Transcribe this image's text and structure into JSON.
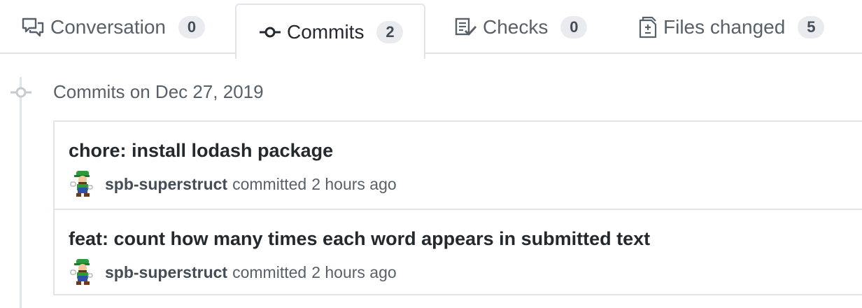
{
  "tabs": [
    {
      "label": "Conversation",
      "count": "0",
      "icon": "comment-discussion-icon",
      "selected": false
    },
    {
      "label": "Commits",
      "count": "2",
      "icon": "git-commit-icon",
      "selected": true
    },
    {
      "label": "Checks",
      "count": "0",
      "icon": "checklist-icon",
      "selected": false
    },
    {
      "label": "Files changed",
      "count": "5",
      "icon": "file-diff-icon",
      "selected": false
    }
  ],
  "commit_group": {
    "header": "Commits on Dec 27, 2019",
    "commits": [
      {
        "title": "chore: install lodash package",
        "author": "spb-superstruct",
        "action": "committed",
        "time": "2 hours ago"
      },
      {
        "title": "feat: count how many times each word appears in submitted text",
        "author": "spb-superstruct",
        "action": "committed",
        "time": "2 hours ago"
      }
    ]
  },
  "colors": {
    "border": "#e1e4e8",
    "muted_text": "#586069",
    "text": "#24292e",
    "counter_bg": "#e9ebee"
  }
}
